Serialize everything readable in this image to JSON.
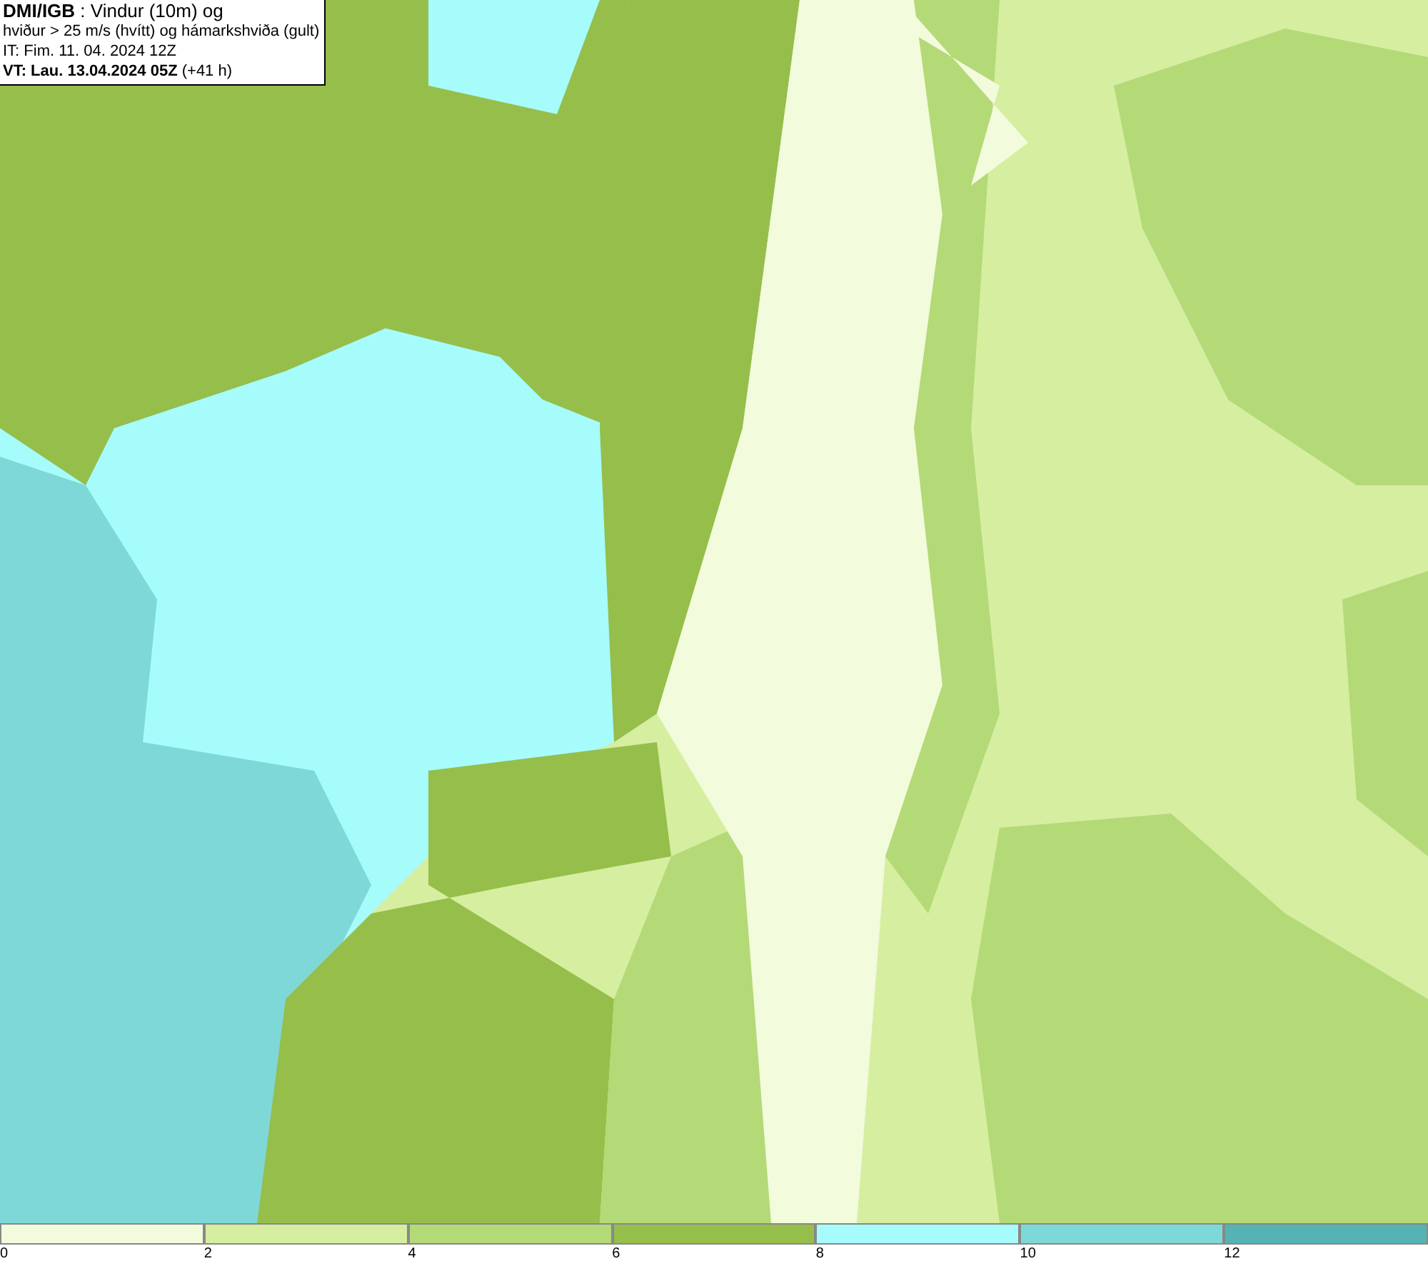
{
  "title_box": {
    "lines": [
      "**DMI/IGB** : Vindur (10m) og",
      "hviður > 25 m/s (hvítt) og hámarkshviða (gult)",
      "IT: Fim. 11. 04. 2024 12Z",
      "**VT: Lau. 13.04.2024 05Z** (+41 h)"
    ]
  },
  "legend": {
    "items": [
      {
        "label": "0",
        "color": "#f2fbdc"
      },
      {
        "label": "2",
        "color": "#d5eea0"
      },
      {
        "label": "4",
        "color": "#b4d977"
      },
      {
        "label": "6",
        "color": "#96be4b"
      },
      {
        "label": "8",
        "color": "#a6fbfb"
      },
      {
        "label": "10",
        "color": "#7fd8d8"
      },
      {
        "label": "12",
        "color": "#55b3b3"
      }
    ]
  }
}
